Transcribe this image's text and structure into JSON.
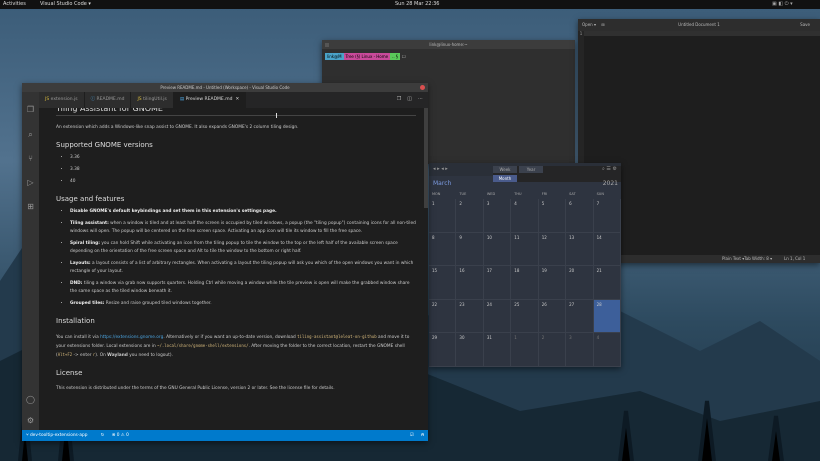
{
  "topbar": {
    "activities": "Activities",
    "app_menu": "Visual Studio Code ▾",
    "clock": "Sun 28 Mar 22:36"
  },
  "terminal": {
    "title": "link@linux-home:~",
    "segments": [
      "link@M",
      "Tree (§) Linux - Home",
      ".. §",
      "☐"
    ]
  },
  "gedit": {
    "open_label": "Open",
    "title": "Untitled Document 1",
    "save_label": "Save",
    "line_number": "1",
    "status": {
      "language": "Plain Text ▾",
      "tab_width": "Tab Width: 8 ▾",
      "position": "Ln 1, Col 1"
    }
  },
  "calendar": {
    "tabs": [
      "Week",
      "Month",
      "Year"
    ],
    "active_tab": "Month",
    "month": "March",
    "year": "2021",
    "weekdays": [
      "MON",
      "TUE",
      "WED",
      "THU",
      "FRI",
      "SAT",
      "SUN"
    ],
    "days": [
      "1",
      "2",
      "3",
      "4",
      "5",
      "6",
      "7",
      "8",
      "9",
      "10",
      "11",
      "12",
      "13",
      "14",
      "15",
      "16",
      "17",
      "18",
      "19",
      "20",
      "21",
      "22",
      "23",
      "24",
      "25",
      "26",
      "27",
      "28",
      "29",
      "30",
      "31",
      "1",
      "2",
      "3",
      "4"
    ],
    "today_index": 27
  },
  "vscode": {
    "title": "Preview README.md - Untitled (Workspace) - Visual Studio Code",
    "tabs": [
      {
        "label": "extension.js",
        "active": false
      },
      {
        "label": "README.md",
        "active": false
      },
      {
        "label": "tilingUtil.js",
        "active": false
      },
      {
        "label": "Preview README.md",
        "active": true
      }
    ],
    "preview": {
      "h1": "Tiling Assistant for GNOME",
      "intro": "An extension which adds a Windows-like snap assist to GNOME. It also expands GNOME's 2 column tiling design.",
      "versions_heading": "Supported GNOME versions",
      "versions": [
        "3.36",
        "3.38",
        "40"
      ],
      "usage_heading": "Usage and features",
      "features": [
        {
          "bold": "Disable GNOME's default keybindings and set them in this extension's settings page.",
          "text": ""
        },
        {
          "bold": "Tiling assistant:",
          "text": " when a window is tiled and at least half the screen is occupied by tiled windows, a popup (the \"tiling popup\") containing icons for all non-tiled windows will open. The popup will be centered on the free screen space. Activating an app icon will tile its window to fill the free space."
        },
        {
          "bold": "Spiral tiling:",
          "text": " you can hold Shift while activating an icon from the tiling popup to tile the window to the top or the left half of the available screen space depending on the orientation of the free screen space and Alt to tile the window to the bottom or right half."
        },
        {
          "bold": "Layouts:",
          "text": " a layout consists of a list of arbitrary rectangles. When activating a layout the tiling popup will ask you which of the open windows you want in which rectangle of your layout."
        },
        {
          "bold": "DND:",
          "text": " tiling a window via grab now supports quarters. Holding Ctrl while moving a window while the tile preview is open will make the grabbed window share the same space as the tiled window beneath it."
        },
        {
          "bold": "Grouped tiles:",
          "text": " Resize and raise grouped tiled windows together."
        }
      ],
      "install_heading": "Installation",
      "install_text_1": "You can install it via ",
      "install_link": "https://extensions.gnome.org",
      "install_text_2": ". Alternatively or if you want an up-to-date version, download ",
      "install_code_1": "tiling-assistant@leleat-on-github",
      "install_text_3": " and move it to your extensions folder. Local extensions are in ",
      "install_code_2": "~/.local/share/gnome-shell/extensions/",
      "install_text_4": ". After moving the folder to the correct location, restart the GNOME shell (",
      "install_code_3": "Alt+F2",
      "install_text_5": " -> enter ",
      "install_code_4": "r",
      "install_text_6": "). On ",
      "install_bold": "Wayland",
      "install_text_7": " you need to logout).",
      "license_heading": "License",
      "license_text": "This extension is distributed under the terms of the GNU General Public License, version 2 or later. See the license file for details."
    },
    "status": {
      "branch": "dev-tooltip-extensions-app",
      "sync": "↻",
      "problems": "⊗ 0 ⚠ 0",
      "right1": "☑",
      "right2": "⍾"
    }
  }
}
